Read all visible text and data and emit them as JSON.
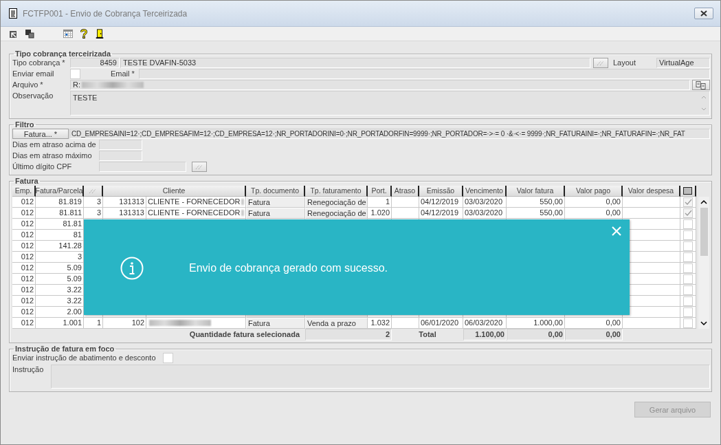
{
  "window": {
    "title": "FCTFP001 - Envio de Cobrança Terceirizada"
  },
  "toolbar": [
    {
      "kind": "export"
    },
    {
      "kind": "windows"
    },
    {
      "kind": "spacer"
    },
    {
      "kind": "calendar"
    },
    {
      "kind": "help"
    },
    {
      "kind": "exit"
    }
  ],
  "tipo_cobranca": {
    "legend": "Tipo cobrança terceirizada",
    "tipo_label": "Tipo cobrança *",
    "tipo_code": "8459",
    "tipo_name": "TESTE DVAFIN-5033",
    "layout_label": "Layout",
    "layout_value": "VirtualAge",
    "enviar_email_label": "Enviar email",
    "enviar_email_checked": false,
    "email_label": "Email *",
    "arquivo_label": "Arquivo *",
    "arquivo_value": "R:",
    "arquivo_redacted": true,
    "observacao_label": "Observação",
    "observacao_value": "TESTE"
  },
  "filtro": {
    "legend": "Filtro",
    "fatura_button": "Fatura... *",
    "fatura_filter": "CD_EMPRESAINI=12·;CD_EMPRESAFIM=12·;CD_EMPRESA=12·;NR_PORTADORINI=0·;NR_PORTADORFIN=9999·;NR_PORTADOR=·>·= 0 ·&·<·= 9999·;NR_FATURAINI=·;NR_FATURAFIN=·;NR_FAT",
    "fields": [
      {
        "label": "Dias em atraso acima de",
        "kind": "short"
      },
      {
        "label": "Dias em atraso máximo",
        "kind": "short"
      },
      {
        "label": "Último dígito CPF",
        "kind": "lookup"
      }
    ]
  },
  "fatura": {
    "legend": "Fatura",
    "columns": [
      {
        "kind": "text",
        "label": "Emp."
      },
      {
        "kind": "text",
        "label": "Fatura/Parcela"
      },
      {
        "kind": "lookup"
      },
      {
        "kind": "wide",
        "label": "Cliente"
      },
      {
        "kind": "text",
        "label": "Tp. documento"
      },
      {
        "kind": "text",
        "label": "Tp. faturamento"
      },
      {
        "kind": "text",
        "label": "Port."
      },
      {
        "kind": "text",
        "label": "Atraso"
      },
      {
        "kind": "text",
        "label": "Emissão"
      },
      {
        "kind": "text",
        "label": "Vencimento"
      },
      {
        "kind": "text",
        "label": "Valor fatura"
      },
      {
        "kind": "text",
        "label": "Valor pago"
      },
      {
        "kind": "text",
        "label": "Valor despesa"
      },
      {
        "kind": "select-all",
        "checked": true
      }
    ],
    "rows": [
      {
        "emp": "012",
        "fatura": "81.819",
        "parcela": "3",
        "cliente_code": "131313",
        "cliente_name": "CLIENTE - FORNECEDOR",
        "cliente_redacted": true,
        "tp_documento": "Fatura",
        "tp_faturamento": "Renegociação de",
        "port": "1",
        "emissao": "04/12/2019",
        "vencimento": "03/03/2020",
        "valor_fatura": "550,00",
        "valor_pago": "0,00",
        "checked": true
      },
      {
        "emp": "012",
        "fatura": "81.811",
        "parcela": "3",
        "cliente_code": "131313",
        "cliente_name": "CLIENTE - FORNECEDOR",
        "cliente_redacted": true,
        "tp_documento": "Fatura",
        "tp_faturamento": "Renegociação de",
        "port": "1.020",
        "emissao": "04/12/2019",
        "vencimento": "03/03/2020",
        "valor_fatura": "550,00",
        "valor_pago": "0,00",
        "checked": true
      },
      {
        "emp": "012",
        "fatura": "81.81",
        "checked": false
      },
      {
        "emp": "012",
        "fatura": "81",
        "checked": false
      },
      {
        "emp": "012",
        "fatura": "141.28",
        "checked": false
      },
      {
        "emp": "012",
        "fatura": "3",
        "checked": false
      },
      {
        "emp": "012",
        "fatura": "5.09",
        "checked": false
      },
      {
        "emp": "012",
        "fatura": "5.09",
        "checked": false
      },
      {
        "emp": "012",
        "fatura": "3.22",
        "checked": false
      },
      {
        "emp": "012",
        "fatura": "3.22",
        "checked": false
      },
      {
        "emp": "012",
        "fatura": "2.00",
        "checked": false
      },
      {
        "emp": "012",
        "fatura": "1.001",
        "parcela": "1",
        "cliente_code": "102",
        "cliente_redacted": true,
        "tp_documento": "Fatura",
        "tp_faturamento": "Venda a prazo",
        "port": "1.032",
        "emissao": "06/01/2020",
        "vencimento": "06/03/2020",
        "valor_fatura": "1.000,00",
        "valor_pago": "0,00",
        "checked": false
      }
    ],
    "footer": {
      "label": "Quantidade fatura selecionada",
      "count": "2",
      "total_label": "Total",
      "valor_fatura": "1.100,00",
      "valor_pago": "0,00",
      "valor_despesa": "0,00"
    }
  },
  "toast": {
    "kind": "info",
    "message": "Envio de cobrança gerado com sucesso."
  },
  "instrucao": {
    "legend": "Instrução de fatura em foco",
    "enviar_label": "Enviar instrução de abatimento e desconto",
    "enviar_checked": false,
    "instrucao_label": "Instrução"
  },
  "gerar_button": {
    "label": "Gerar arquivo",
    "disabled": true
  }
}
